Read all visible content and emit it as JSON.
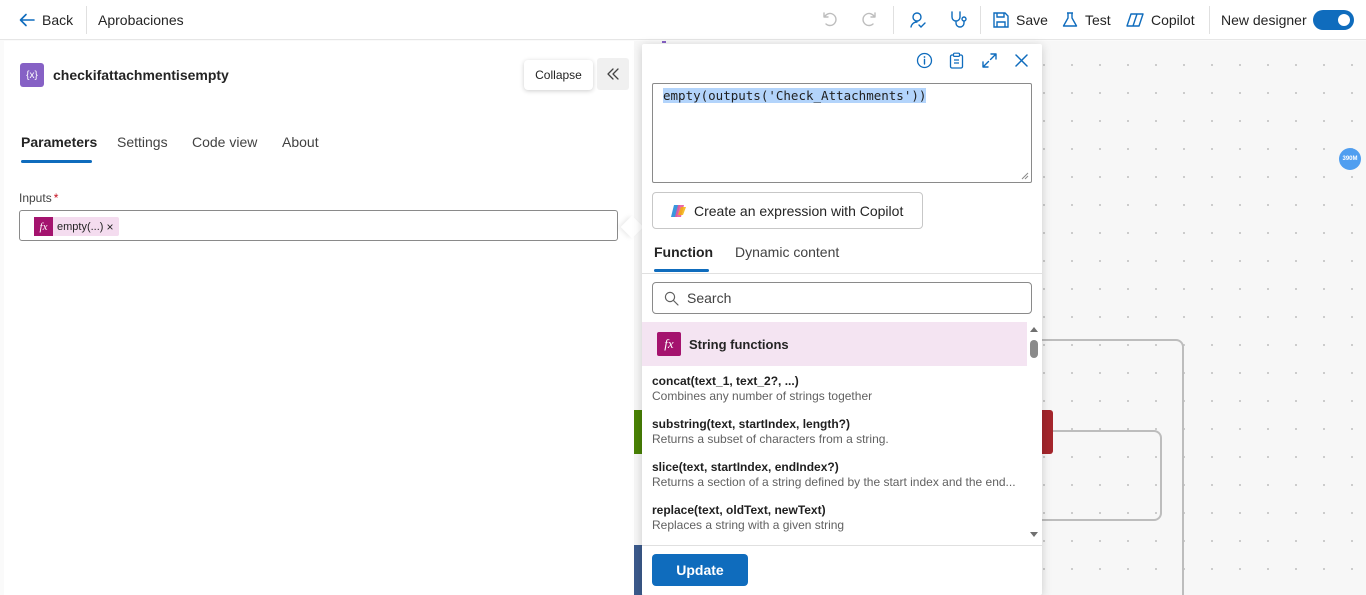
{
  "topbar": {
    "back_label": "Back",
    "flow_name": "Aprobaciones",
    "save_label": "Save",
    "test_label": "Test",
    "copilot_label": "Copilot",
    "new_designer_label": "New designer",
    "new_designer_on": true,
    "accent": "#0f6cbd"
  },
  "panel": {
    "action_title": "checkifattachmentisempty",
    "collapse_tooltip": "Collapse",
    "tabs": [
      "Parameters",
      "Settings",
      "Code view",
      "About"
    ],
    "active_tab": "Parameters",
    "inputs_label": "Inputs",
    "required_mark": "*",
    "token_label": "empty(...)",
    "token_remove": "×",
    "fx_glyph": "fx"
  },
  "expression": {
    "text": "empty(outputs('Check_Attachments'))",
    "copilot_button": "Create an expression with Copilot",
    "tabs": [
      "Function",
      "Dynamic content"
    ],
    "active_tab": "Function",
    "search_placeholder": "Search",
    "category": "String functions",
    "functions": [
      {
        "name": "concat(text_1, text_2?, ...)",
        "desc": "Combines any number of strings together"
      },
      {
        "name": "substring(text, startIndex, length?)",
        "desc": "Returns a subset of characters from a string."
      },
      {
        "name": "slice(text, startIndex, endIndex?)",
        "desc": "Returns a section of a string defined by the start index and the end..."
      },
      {
        "name": "replace(text, oldText, newText)",
        "desc": "Replaces a string with a given string"
      }
    ],
    "update_label": "Update"
  },
  "canvas": {
    "zoom_badge": "390M"
  }
}
